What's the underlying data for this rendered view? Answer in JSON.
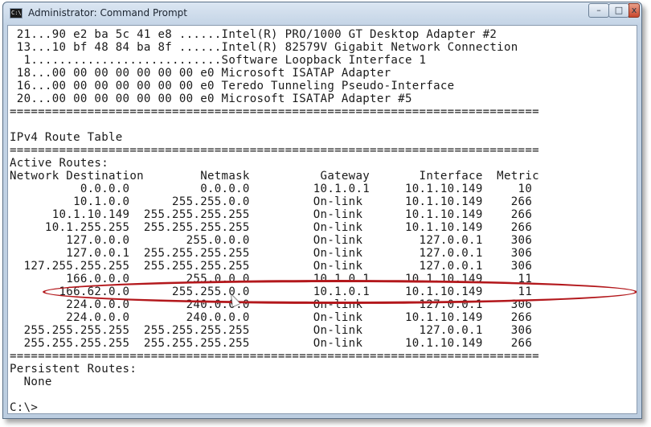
{
  "window": {
    "title": "Administrator: Command Prompt",
    "app_icon_text": "C:\\",
    "buttons": {
      "minimize": "–",
      "maximize": "□",
      "close": "x"
    }
  },
  "console": {
    "lines": [
      " 21...90 e2 ba 5c 41 e8 ......Intel(R) PRO/1000 GT Desktop Adapter #2",
      " 13...10 bf 48 84 ba 8f ......Intel(R) 82579V Gigabit Network Connection",
      "  1...........................Software Loopback Interface 1",
      " 18...00 00 00 00 00 00 00 e0 Microsoft ISATAP Adapter",
      " 16...00 00 00 00 00 00 00 e0 Teredo Tunneling Pseudo-Interface",
      " 20...00 00 00 00 00 00 00 e0 Microsoft ISATAP Adapter #5",
      "===========================================================================",
      "",
      "IPv4 Route Table",
      "===========================================================================",
      "Active Routes:",
      "Network Destination        Netmask          Gateway       Interface  Metric",
      "          0.0.0.0          0.0.0.0         10.1.0.1     10.1.10.149     10",
      "         10.1.0.0      255.255.0.0         On-link      10.1.10.149    266",
      "      10.1.10.149  255.255.255.255         On-link      10.1.10.149    266",
      "     10.1.255.255  255.255.255.255         On-link      10.1.10.149    266",
      "        127.0.0.0        255.0.0.0         On-link        127.0.0.1    306",
      "        127.0.0.1  255.255.255.255         On-link        127.0.0.1    306",
      "  127.255.255.255  255.255.255.255         On-link        127.0.0.1    306",
      "        166.0.0.0        255.0.0.0         10.1.0.1     10.1.10.149     11",
      "       166.62.0.0      255.255.0.0         10.1.0.1     10.1.10.149     11",
      "        224.0.0.0        240.0.0.0         On-link        127.0.0.1    306",
      "        224.0.0.0        240.0.0.0         On-link      10.1.10.149    266",
      "  255.255.255.255  255.255.255.255         On-link        127.0.0.1    306",
      "  255.255.255.255  255.255.255.255         On-link      10.1.10.149    266",
      "===========================================================================",
      "Persistent Routes:",
      "  None",
      "",
      "C:\\>"
    ]
  },
  "colors": {
    "highlight_ring": "#b3181c",
    "console_text": "#1a1a1a",
    "console_background": "#ffffff"
  },
  "icons": {
    "app": "cmd-icon",
    "cursor": "mouse-pointer-icon"
  }
}
